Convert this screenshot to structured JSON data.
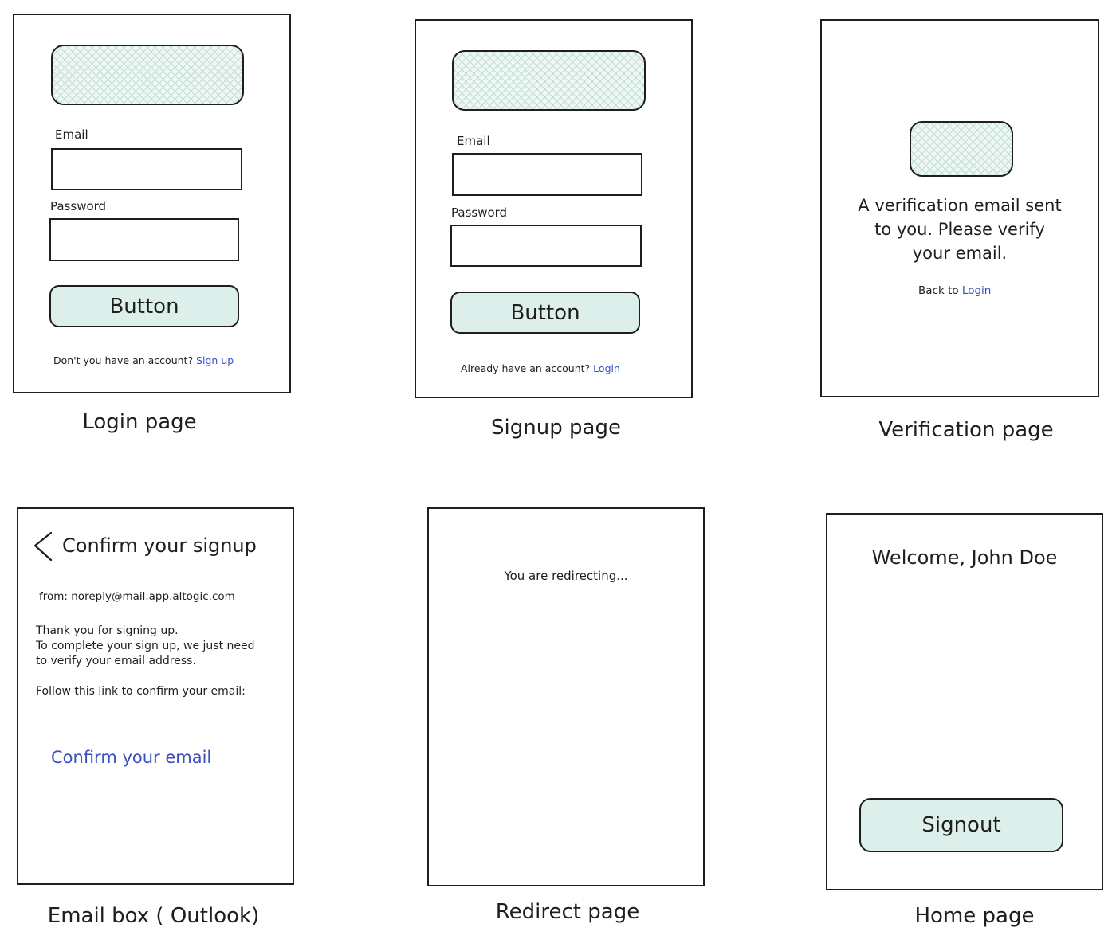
{
  "login": {
    "caption": "Login page",
    "email_label": "Email",
    "password_label": "Password",
    "button_label": "Button",
    "footer_text": "Don't you have an account?",
    "footer_link": "Sign up"
  },
  "signup": {
    "caption": "Signup page",
    "email_label": "Email",
    "password_label": "Password",
    "button_label": "Button",
    "footer_text": "Already have an account?",
    "footer_link": "Login"
  },
  "verification": {
    "caption": "Verification page",
    "message_line1": "A verification email sent",
    "message_line2": "to you. Please verify",
    "message_line3": "your email.",
    "back_text": "Back to",
    "back_link": "Login"
  },
  "email_box": {
    "caption": "Email box ( Outlook)",
    "back_icon": "chevron-left-icon",
    "title": "Confirm your signup",
    "from": "from: noreply@mail.app.altogic.com",
    "line1": "Thank you for signing up.",
    "line2": "To complete your sign up, we just need",
    "line3": "to verify your email address.",
    "line4": "Follow this link to confirm your email:",
    "confirm_link": "Confirm your email"
  },
  "redirect": {
    "caption": "Redirect page",
    "message": "You are redirecting..."
  },
  "home": {
    "caption": "Home page",
    "welcome": "Welcome, John Doe",
    "signout_label": "Signout"
  },
  "colors": {
    "link": "#3b4fc4",
    "button_fill": "#dcefeb",
    "hatch_fill": "#eef7f4",
    "stroke": "#1e1e1e"
  }
}
